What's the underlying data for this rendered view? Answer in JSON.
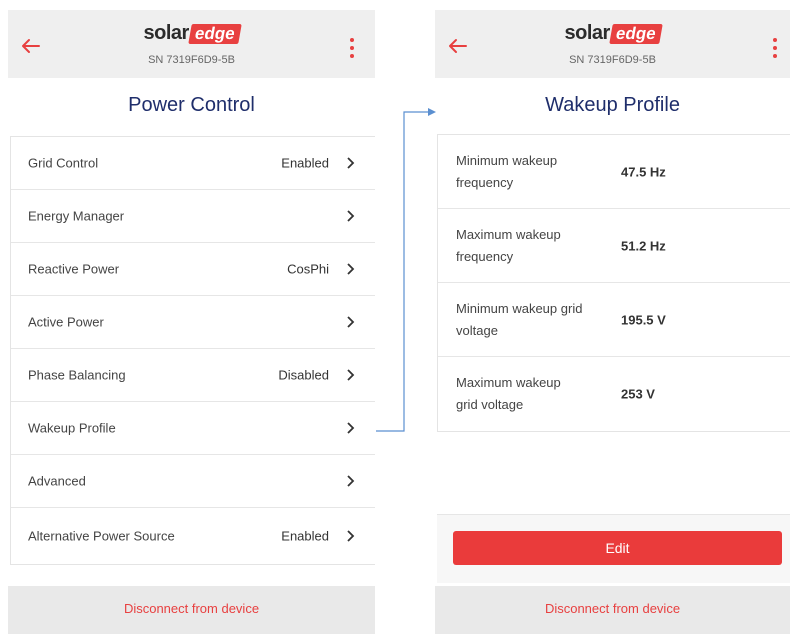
{
  "brand": {
    "part1": "solar",
    "part2": "edge",
    "accent_color": "#e84040",
    "title_color": "#1f2e6b"
  },
  "left_screen": {
    "serial": "SN 7319F6D9-5B",
    "title": "Power Control",
    "items": [
      {
        "label": "Grid Control",
        "value": "Enabled"
      },
      {
        "label": "Energy Manager",
        "value": ""
      },
      {
        "label": "Reactive Power",
        "value": "CosPhi"
      },
      {
        "label": "Active Power",
        "value": ""
      },
      {
        "label": "Phase Balancing",
        "value": "Disabled"
      },
      {
        "label": "Wakeup Profile",
        "value": ""
      },
      {
        "label": "Advanced",
        "value": ""
      },
      {
        "label": "Alternative Power Source",
        "value": "Enabled"
      }
    ],
    "disconnect_label": "Disconnect from device"
  },
  "right_screen": {
    "serial": "SN 7319F6D9-5B",
    "title": "Wakeup Profile",
    "params": [
      {
        "label": "Minimum wakeup frequency",
        "value": "47.5 Hz"
      },
      {
        "label": "Maximum wakeup frequency",
        "value": "51.2 Hz"
      },
      {
        "label": "Minimum wakeup grid voltage",
        "value": "195.5 V"
      },
      {
        "label": "Maximum wakeup grid voltage",
        "value": "253 V"
      }
    ],
    "edit_label": "Edit",
    "disconnect_label": "Disconnect from device"
  },
  "icons": {
    "back": "arrow-left-icon",
    "more": "more-vertical-icon",
    "chevron": "chevron-right-icon"
  }
}
